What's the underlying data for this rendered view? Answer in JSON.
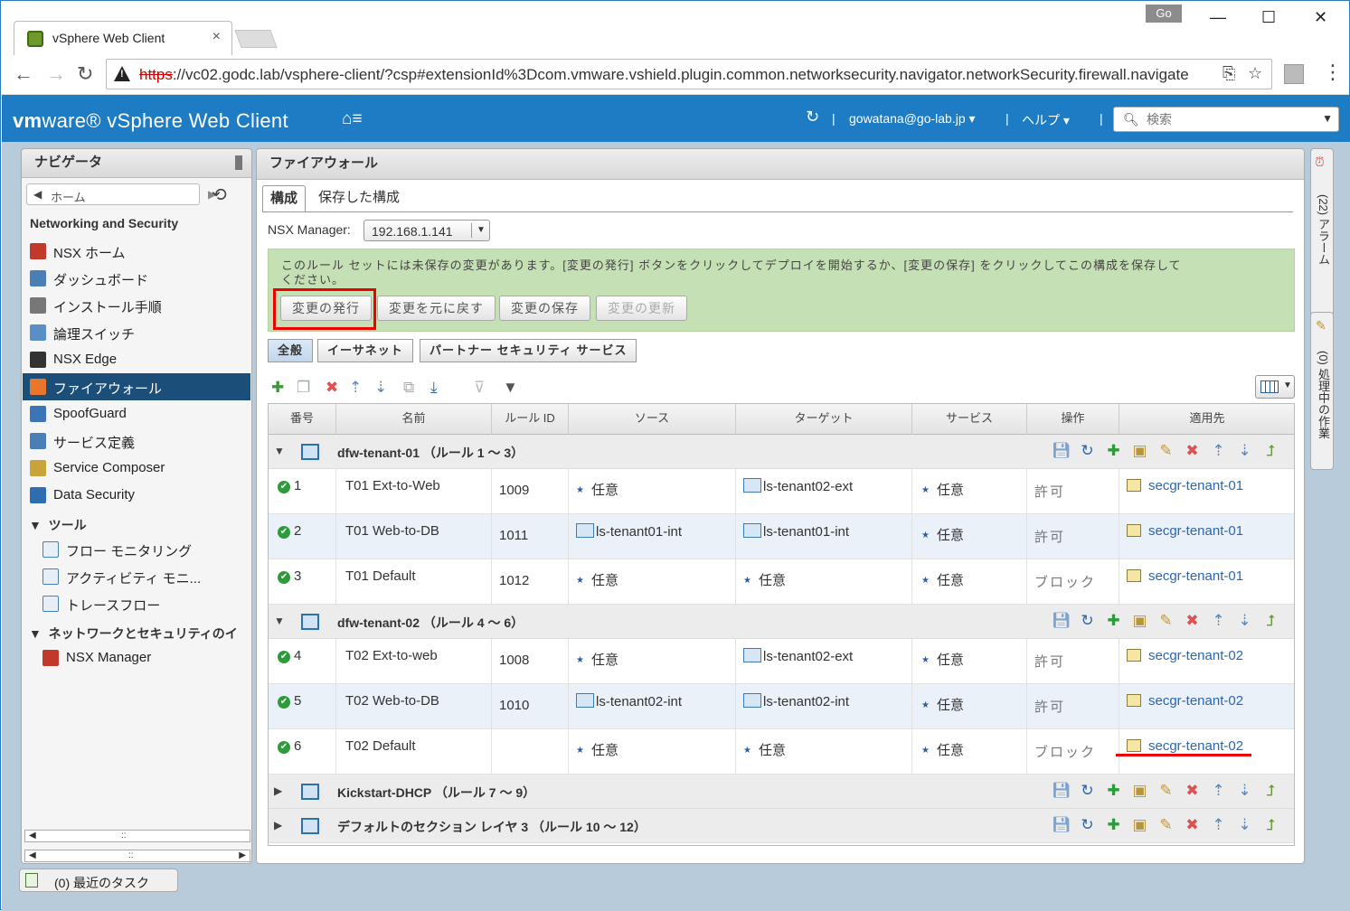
{
  "browser": {
    "tab_title": "vSphere Web Client",
    "tab_close": "×",
    "go_button": "Go",
    "url_scheme": "https",
    "url_rest": "://vc02.godc.lab/vsphere-client/?csp#extensionId%3Dcom.vmware.vshield.plugin.common.networksecurity.navigator.networkSecurity.firewall.navigate"
  },
  "header": {
    "logo_vm": "vm",
    "logo_ware": "ware",
    "logo_rest": "® vSphere Web Client",
    "user": "gowatana@go-lab.jp ▾",
    "help": "ヘルプ ▾",
    "search_placeholder": "検索"
  },
  "navigator": {
    "title": "ナビゲータ",
    "home": "ホーム",
    "section": "Networking and Security",
    "items": [
      {
        "label": "NSX ホーム",
        "color": "#c0392b"
      },
      {
        "label": "ダッシュボード",
        "color": "#4a7fb5"
      },
      {
        "label": "インストール手順",
        "color": "#777777"
      },
      {
        "label": "論理スイッチ",
        "color": "#5a8fc5"
      },
      {
        "label": "NSX Edge",
        "color": "#333333"
      },
      {
        "label": "ファイアウォール",
        "color": "#e8762c"
      },
      {
        "label": "SpoofGuard",
        "color": "#3c75b5"
      },
      {
        "label": "サービス定義",
        "color": "#4a7fb5"
      },
      {
        "label": "Service Composer",
        "color": "#c9a43a"
      },
      {
        "label": "Data Security",
        "color": "#2d6db0"
      }
    ],
    "tools_group": "ツール",
    "tools": [
      {
        "label": "フロー モニタリング",
        "color": "#4a7fb5"
      },
      {
        "label": "アクティビティ モニ...",
        "color": "#4a7fb5"
      },
      {
        "label": "トレースフロー",
        "color": "#4a7fb5"
      }
    ],
    "net_group": "ネットワークとセキュリティのイ",
    "net_items": [
      {
        "label": "NSX Manager",
        "color": "#c0392b"
      }
    ],
    "recent_tasks": "(0) 最近のタスク"
  },
  "main": {
    "title": "ファイアウォール",
    "tabs": [
      "構成",
      "保存した構成"
    ],
    "nsx_label": "NSX Manager:",
    "nsx_value": "192.168.1.141",
    "notice": "このルール セットには未保存の変更があります。[変更の発行] ボタンをクリックしてデプロイを開始するか、[変更の保存] をクリックしてこの構成を保存してください。",
    "buttons": {
      "publish": "変更の発行",
      "revert": "変更を元に戻す",
      "save": "変更の保存",
      "update": "変更の更新"
    },
    "subtabs": [
      "全般",
      "イーサネット",
      "パートナー セキュリティ サービス"
    ],
    "columns": [
      "番号",
      "名前",
      "ルール ID",
      "ソース",
      "ターゲット",
      "サービス",
      "操作",
      "適用先"
    ],
    "sections": [
      {
        "title": "dfw-tenant-01 （ルール 1 ～ 3）",
        "expanded": true,
        "rules": [
          {
            "no": "1",
            "name": "T01 Ext-to-Web",
            "id": "1009",
            "source": "任意",
            "source_vm": false,
            "target": "ls-tenant02-ext",
            "target_vm": true,
            "service": "任意",
            "action": "許可",
            "applied": "secgr-tenant-01"
          },
          {
            "no": "2",
            "name": "T01 Web-to-DB",
            "id": "1011",
            "source": "ls-tenant01-int",
            "source_vm": true,
            "target": "ls-tenant01-int",
            "target_vm": true,
            "service": "任意",
            "action": "許可",
            "applied": "secgr-tenant-01"
          },
          {
            "no": "3",
            "name": "T01 Default",
            "id": "1012",
            "source": "任意",
            "source_vm": false,
            "target": "任意",
            "target_vm": false,
            "service": "任意",
            "action": "ブロック",
            "applied": "secgr-tenant-01"
          }
        ]
      },
      {
        "title": "dfw-tenant-02 （ルール 4 ～ 6）",
        "expanded": true,
        "rules": [
          {
            "no": "4",
            "name": "T02 Ext-to-web",
            "id": "1008",
            "source": "任意",
            "source_vm": false,
            "target": "ls-tenant02-ext",
            "target_vm": true,
            "service": "任意",
            "action": "許可",
            "applied": "secgr-tenant-02"
          },
          {
            "no": "5",
            "name": "T02 Web-to-DB",
            "id": "1010",
            "source": "ls-tenant02-int",
            "source_vm": true,
            "target": "ls-tenant02-int",
            "target_vm": true,
            "service": "任意",
            "action": "許可",
            "applied": "secgr-tenant-02"
          },
          {
            "no": "6",
            "name": "T02 Default",
            "id": "",
            "source": "任意",
            "source_vm": false,
            "target": "任意",
            "target_vm": false,
            "service": "任意",
            "action": "ブロック",
            "applied": "secgr-tenant-02"
          }
        ]
      },
      {
        "title": "Kickstart-DHCP （ルール 7 ～ 9）",
        "expanded": false,
        "rules": []
      },
      {
        "title": "デフォルトのセクション レイヤ 3 （ルール 10 ～ 12）",
        "expanded": false,
        "rules": []
      }
    ]
  },
  "right_panel": {
    "alarms": "(22) アラーム",
    "work": "(0) 処理中の作業"
  }
}
